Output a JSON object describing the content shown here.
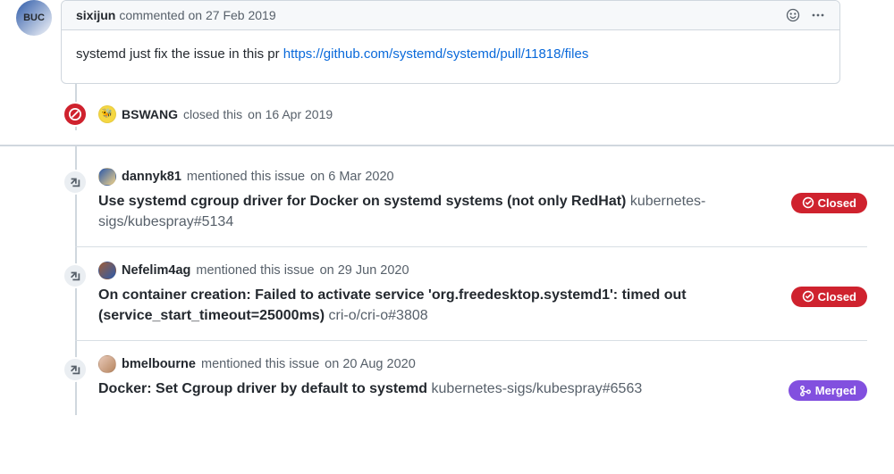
{
  "comment": {
    "author": "sixijun",
    "action": "commented",
    "datePrefix": "on",
    "date": "27 Feb 2019",
    "body_prefix": "systemd just fix the issue in this pr ",
    "body_link": "https://github.com/systemd/systemd/pull/11818/files"
  },
  "close_event": {
    "author": "BSWANG",
    "action": "closed this",
    "datePrefix": "on",
    "date": "16 Apr 2019"
  },
  "refs": [
    {
      "author": "dannyk81",
      "action": "mentioned this issue",
      "datePrefix": "on",
      "date": "6 Mar 2020",
      "title": "Use systemd cgroup driver for Docker on systemd systems (not only RedHat)",
      "repo_ref": "kubernetes-sigs/kubespray#5134",
      "status": "Closed",
      "status_kind": "closed"
    },
    {
      "author": "Nefelim4ag",
      "action": "mentioned this issue",
      "datePrefix": "on",
      "date": "29 Jun 2020",
      "title": "On container creation: Failed to activate service 'org.freedesktop.systemd1': timed out (service_start_timeout=25000ms)",
      "repo_ref": "cri-o/cri-o#3808",
      "status": "Closed",
      "status_kind": "closed"
    },
    {
      "author": "bmelbourne",
      "action": "mentioned this issue",
      "datePrefix": "on",
      "date": "20 Aug 2020",
      "title": "Docker: Set Cgroup driver by default to systemd",
      "repo_ref": "kubernetes-sigs/kubespray#6563",
      "status": "Merged",
      "status_kind": "merged"
    }
  ],
  "icons": {
    "smiley": "smiley-icon",
    "kebab": "kebab-icon",
    "closed": "closed-icon",
    "xref": "cross-reference-icon",
    "closed_pill": "issue-closed-icon",
    "merged_pill": "git-merge-icon"
  },
  "colors": {
    "closed": "#cf222e",
    "merged": "#8250df",
    "link": "#0969da"
  }
}
